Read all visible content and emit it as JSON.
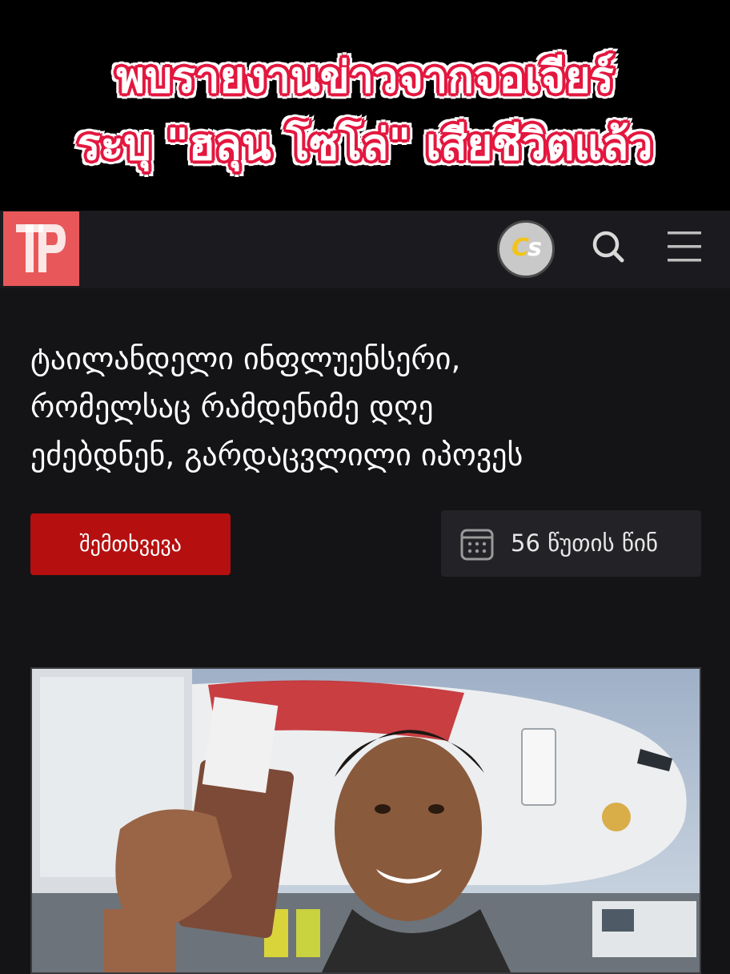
{
  "caption": {
    "line1": "พบรายงานข่าวจากจอเจียร์",
    "line2": "ระบุ \"ฮลุน โซโล่\" เสียชีวิตแล้ว"
  },
  "header": {
    "logo_icon": "ip-logo-icon",
    "badge_text_c": "C",
    "badge_text_s": "s",
    "search_icon": "search-icon",
    "menu_icon": "hamburger-menu-icon"
  },
  "article": {
    "headline_line1": "ტაილანდელი ინფლუენსერი,",
    "headline_line2": "რომელსაც რამდენიმე დღე",
    "headline_line3": "ეძებდნენ, გარდაცვლილი იპოვეს",
    "category": "შემთხვევა",
    "time_ago": "56 წუთის წინ",
    "calendar_icon": "calendar-icon"
  },
  "colors": {
    "accent_red": "#b50f10",
    "logo_red": "#e8585a",
    "caption_outline": "#e3173f",
    "background": "#141417"
  }
}
